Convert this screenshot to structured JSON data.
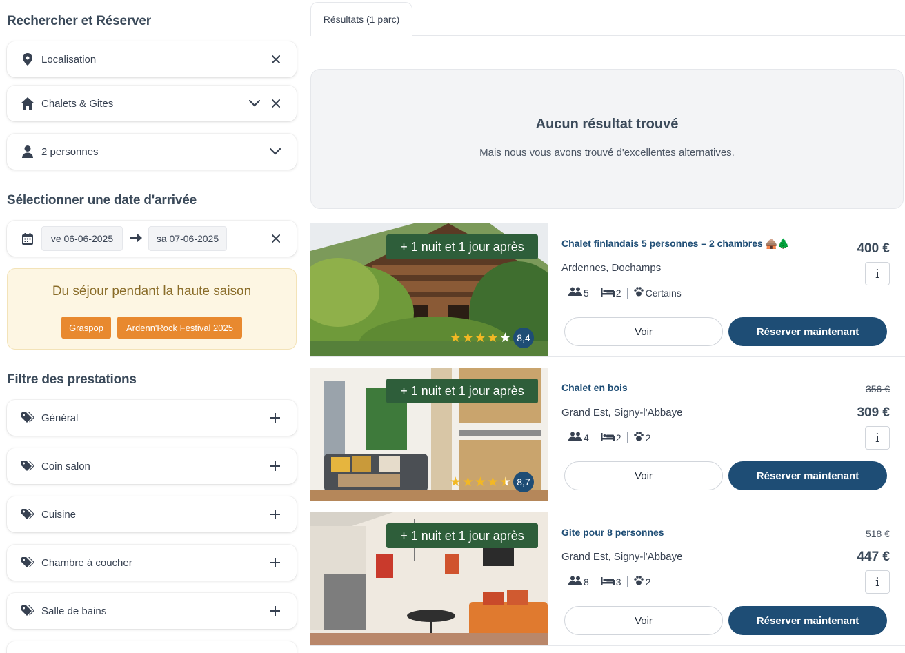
{
  "sidebar": {
    "search_title": "Rechercher et Réserver",
    "location_label": "Localisation",
    "category_label": "Chalets & Gites",
    "persons_label": "2 personnes",
    "date_title": "Sélectionner une date d'arrivée",
    "date_from": "ve 06-06-2025",
    "date_to": "sa 07-06-2025",
    "season": {
      "title": "Du séjour pendant la haute saison",
      "events": [
        "Graspop",
        "Ardenn'Rock Festival 2025"
      ]
    },
    "filter_title": "Filtre des prestations",
    "filters": [
      "Général",
      "Coin salon",
      "Cuisine",
      "Chambre à coucher",
      "Salle de bains"
    ]
  },
  "main": {
    "tab_label": "Résultats (1 parc)",
    "no_result": {
      "title": "Aucun résultat trouvé",
      "subtitle": "Mais nous vous avons trouvé d'excellentes alternatives."
    },
    "cards": [
      {
        "badge": "+ 1 nuit et 1 jour après",
        "title": "Chalet finlandais 5 personnes – 2 chambres 🛖🌲",
        "location": "Ardennes, Dochamps",
        "persons": "5",
        "bedrooms": "2",
        "pets": "Certains",
        "old_price": "",
        "price": "400 €",
        "rating": "8,4",
        "stars": 4,
        "info": "i",
        "view_label": "Voir",
        "book_label": "Réserver maintenant"
      },
      {
        "badge": "+ 1 nuit et 1 jour après",
        "title": "Chalet en bois",
        "location": "Grand Est, Signy-l'Abbaye",
        "persons": "4",
        "bedrooms": "2",
        "pets": "2",
        "old_price": "356 €",
        "price": "309 €",
        "rating": "8,7",
        "stars": 4.5,
        "info": "i",
        "view_label": "Voir",
        "book_label": "Réserver maintenant"
      },
      {
        "badge": "+ 1 nuit et 1 jour après",
        "title": "Gite pour 8 personnes",
        "location": "Grand Est, Signy-l'Abbaye",
        "persons": "8",
        "bedrooms": "3",
        "pets": "2",
        "old_price": "518 €",
        "price": "447 €",
        "rating": "",
        "info": "i",
        "view_label": "Voir",
        "book_label": "Réserver maintenant"
      }
    ]
  },
  "colors": {
    "primary": "#1e4d75",
    "badge_green": "#2e5e3a",
    "chip_orange": "#e8892f",
    "season_bg": "#fdf6e3",
    "star": "#f2b824"
  },
  "icons": [
    "map-pin-icon",
    "home-icon",
    "user-icon",
    "calendar-icon",
    "arrow-right-icon",
    "tag-icon",
    "plus-icon",
    "close-icon",
    "chevron-down-icon",
    "users-icon",
    "bed-icon",
    "paw-icon",
    "star-icon",
    "info-icon"
  ]
}
